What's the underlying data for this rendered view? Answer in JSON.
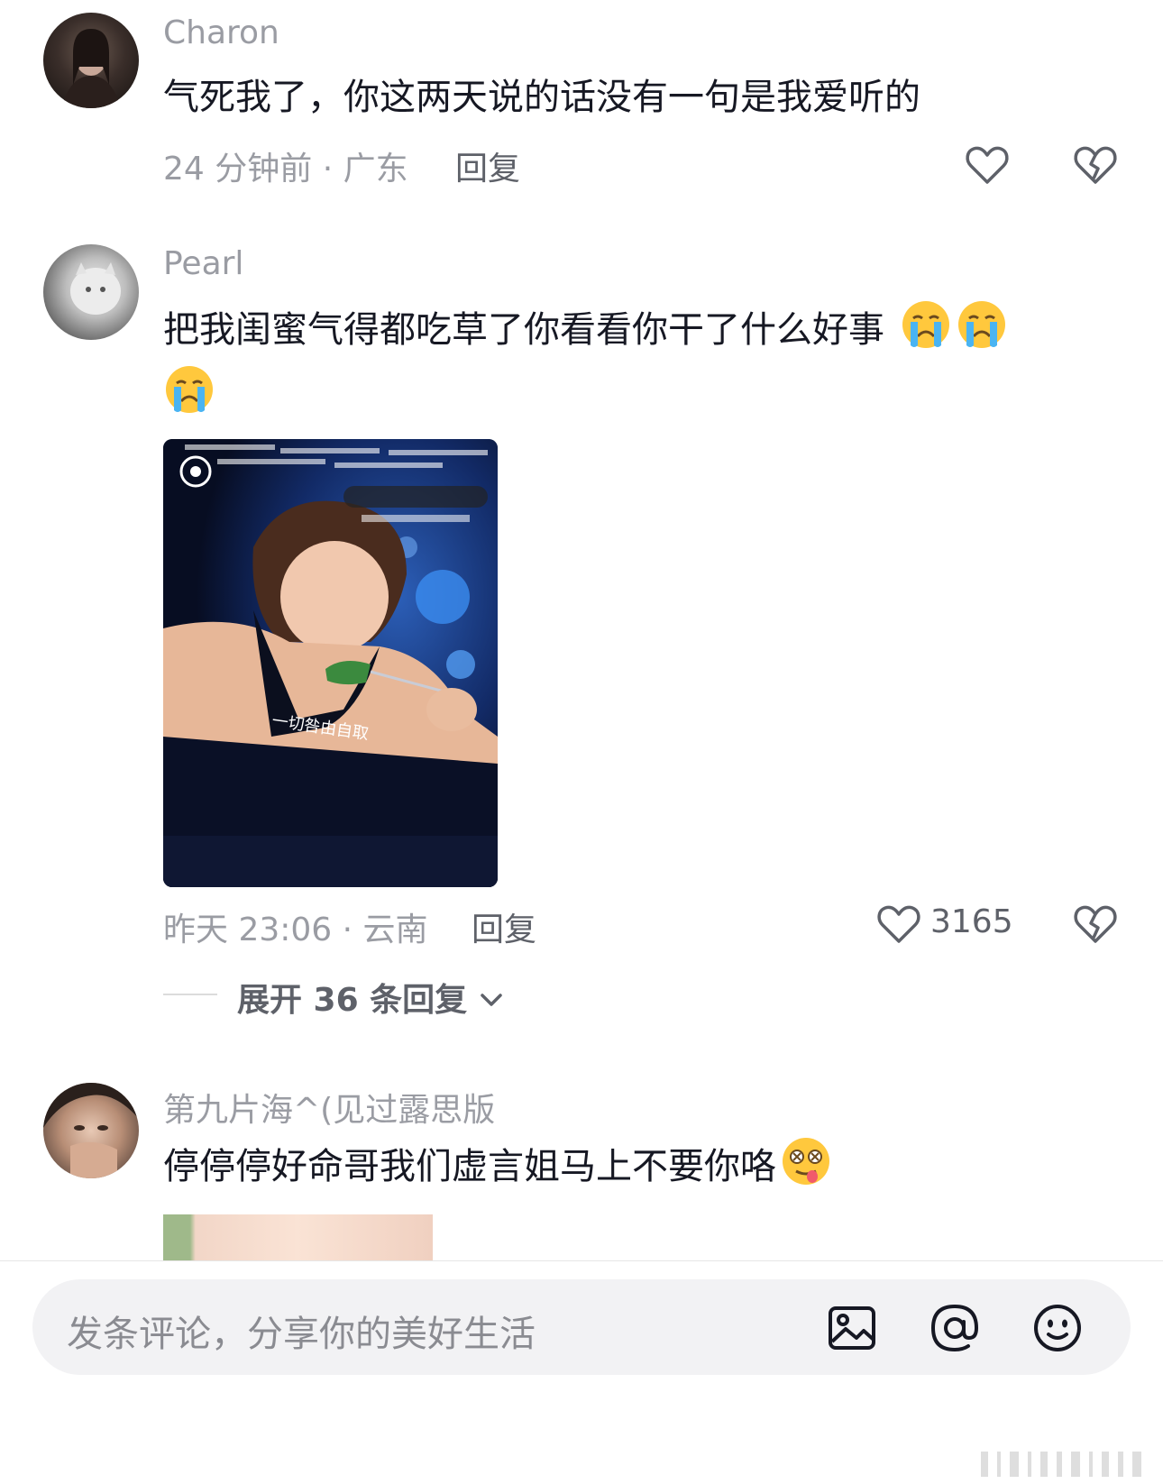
{
  "comments": [
    {
      "username": "Charon",
      "text": "气死我了，你这两天说的话没有一句是我爱听的",
      "meta": "24 分钟前 · 广东",
      "reply_label": "回复",
      "likes": ""
    },
    {
      "username": "Pearl",
      "text": "把我闺蜜气得都吃草了你看看你干了什么好事",
      "meta": "昨天 23:06 · 云南",
      "reply_label": "回复",
      "likes": "3165",
      "image_caption": "一切咎由自取",
      "image_overlay_lines": [
        "孩子能吃，多为肺热",
        "这里我看了好多遍，演的好好",
        "我们闺蜜哭成泪",
        "这饭吃的好心烦",
        "宝贝"
      ],
      "expand_label": "展开 36 条回复"
    },
    {
      "username": "第九片海^(见过露思版",
      "text": "停停停好命哥我们虚言姐马上不要你咯"
    }
  ],
  "input": {
    "placeholder": "发条评论，分享你的美好生活"
  },
  "icons": {
    "like": "heart-outline-icon",
    "dislike": "broken-heart-icon",
    "image": "image-icon",
    "mention": "at-icon",
    "emoji": "smiley-icon",
    "expand": "chevron-down-icon"
  }
}
